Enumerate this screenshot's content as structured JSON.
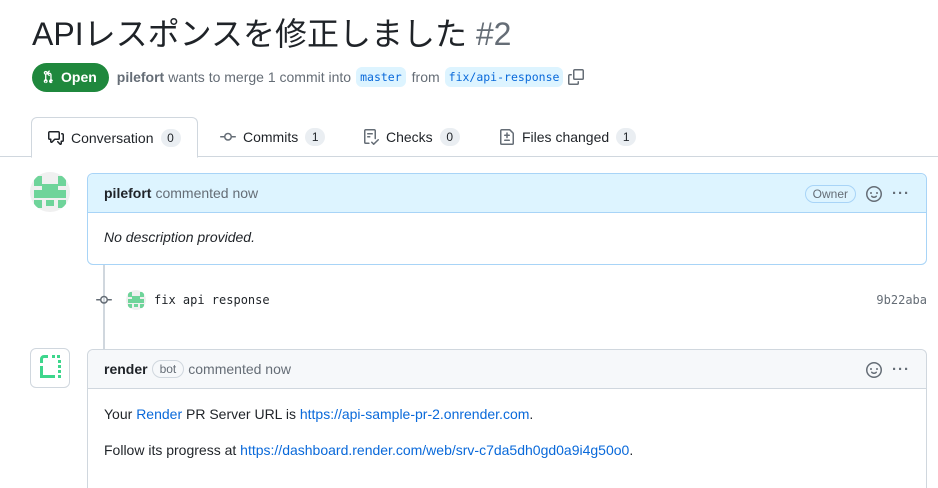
{
  "pr": {
    "title": "APIレスポンスを修正しました",
    "number": "#2",
    "state": "Open",
    "author": "pilefort",
    "merge_text": "wants to merge 1 commit into",
    "base_branch": "master",
    "from_text": "from",
    "head_branch": "fix/api-response"
  },
  "tabs": [
    {
      "label": "Conversation",
      "count": "0"
    },
    {
      "label": "Commits",
      "count": "1"
    },
    {
      "label": "Checks",
      "count": "0"
    },
    {
      "label": "Files changed",
      "count": "1"
    }
  ],
  "comment1": {
    "author": "pilefort",
    "action": "commented now",
    "badge": "Owner",
    "body": "No description provided."
  },
  "commit": {
    "message": "fix api response",
    "sha": "9b22aba"
  },
  "comment2": {
    "author": "render",
    "bot_label": "bot",
    "action": "commented now",
    "line1_prefix": "Your ",
    "line1_link": "Render",
    "line1_mid": " PR Server URL is ",
    "line1_url": "https://api-sample-pr-2.onrender.com",
    "line1_suffix": ".",
    "line2_prefix": "Follow its progress at ",
    "line2_url": "https://dashboard.render.com/web/srv-c7da5dh0gd0a9i4g50o0",
    "line2_suffix": "."
  },
  "colors": {
    "open_green": "#1f883d",
    "link_blue": "#0969da",
    "highlight_bg": "#ddf4ff",
    "avatar_green": "#6fd49a"
  },
  "icons": [
    "pull-request-icon",
    "copy-icon",
    "conversation-icon",
    "commit-icon",
    "checks-icon",
    "file-diff-icon",
    "smiley-icon",
    "kebab-icon",
    "render-logo-icon"
  ]
}
